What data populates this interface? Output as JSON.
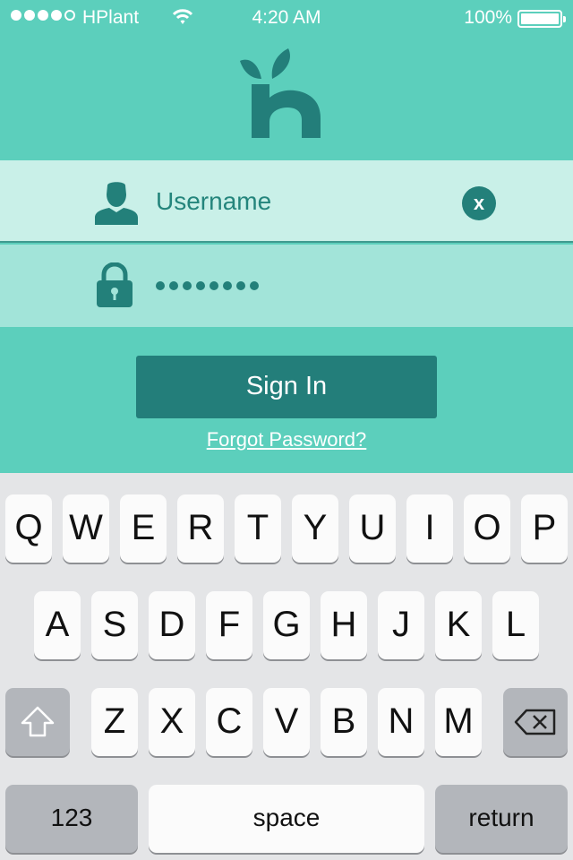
{
  "status_bar": {
    "carrier": "HPlant",
    "time": "4:20 AM",
    "battery": "100%"
  },
  "login": {
    "username_placeholder": "Username",
    "clear_label": "x",
    "password_masked_length": 8,
    "sign_in_label": "Sign In",
    "forgot_password_label": "Forgot Password?"
  },
  "colors": {
    "background": "#5ccfbc",
    "primary_dark": "#237e7a",
    "username_field": "#c9f0e8",
    "password_field": "#a2e4d9"
  },
  "keyboard": {
    "row1": [
      "Q",
      "W",
      "E",
      "R",
      "T",
      "Y",
      "U",
      "I",
      "O",
      "P"
    ],
    "row2": [
      "A",
      "S",
      "D",
      "F",
      "G",
      "H",
      "J",
      "K",
      "L"
    ],
    "row3": [
      "Z",
      "X",
      "C",
      "V",
      "B",
      "N",
      "M"
    ],
    "shift_icon": "shift-icon",
    "backspace_icon": "backspace-icon",
    "numbers_label": "123",
    "space_label": "space",
    "return_label": "return"
  }
}
